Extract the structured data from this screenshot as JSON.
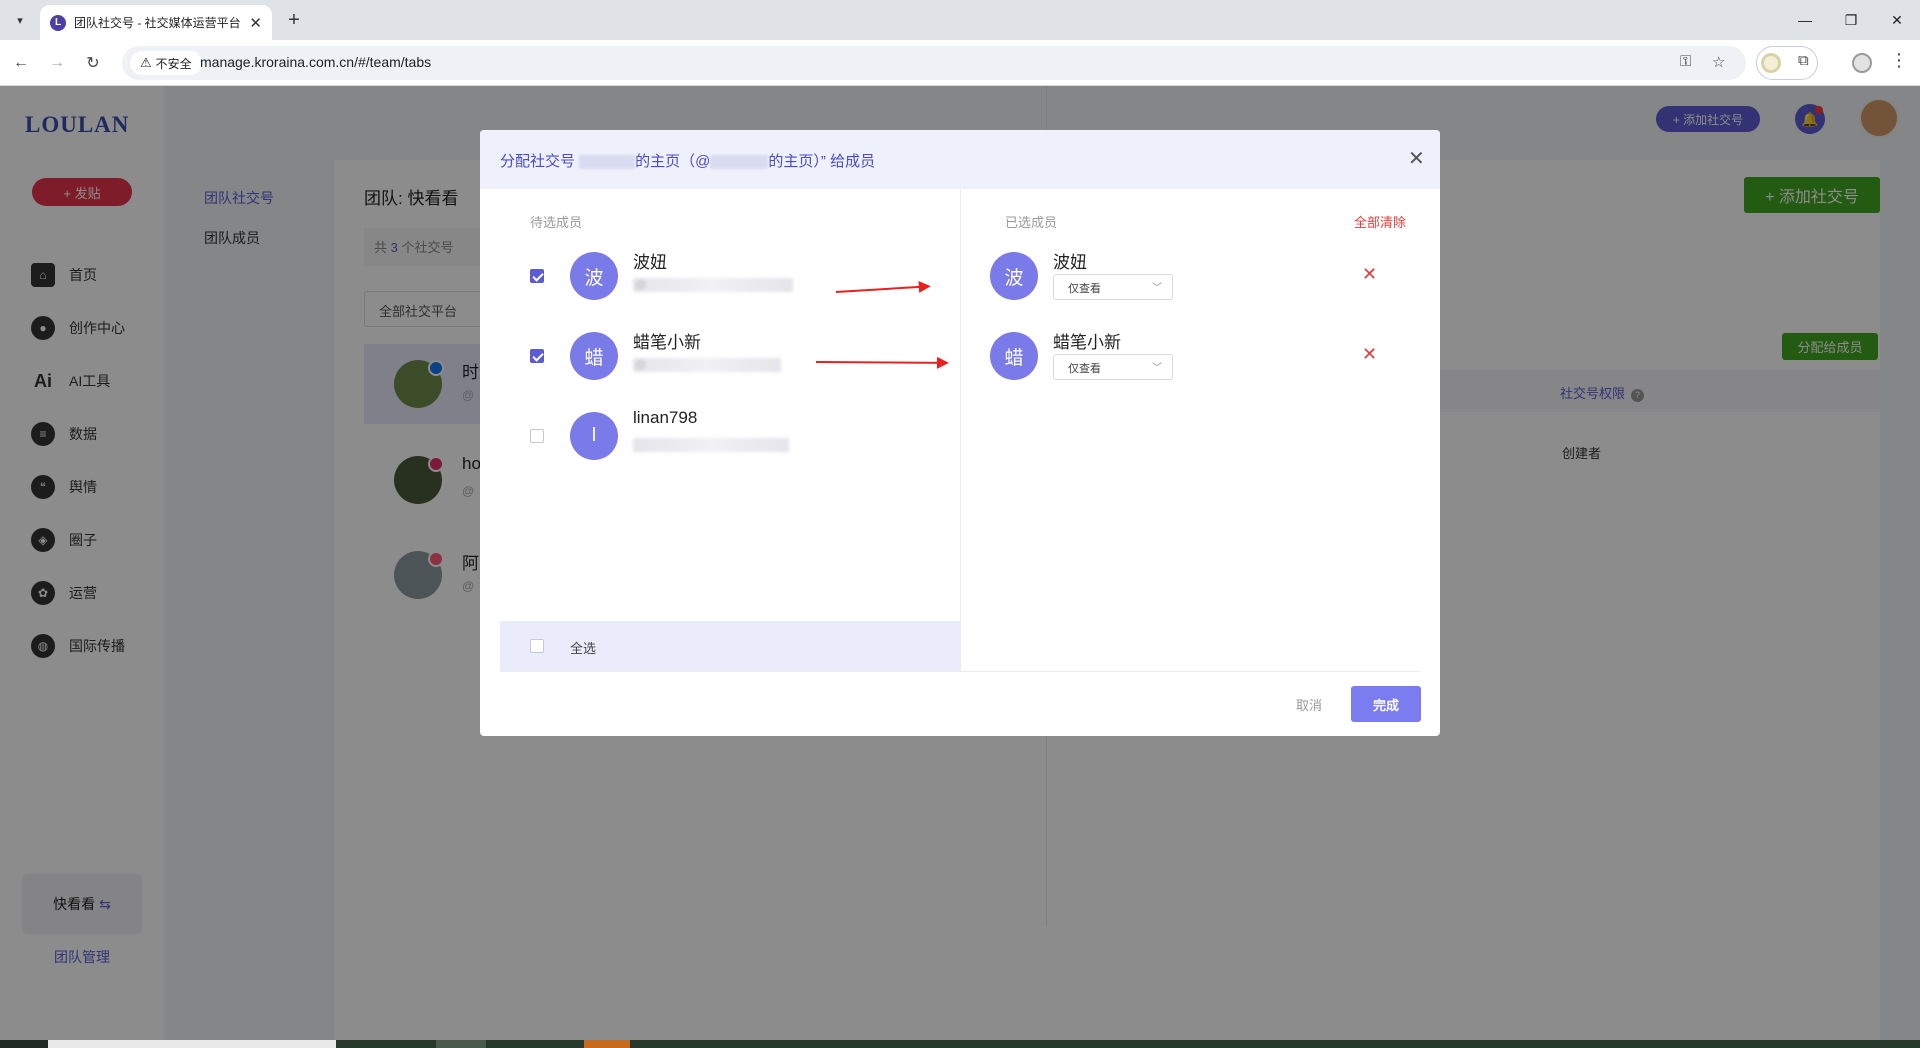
{
  "browser": {
    "tab_title": "团队社交号 - 社交媒体运营平台",
    "security_label": "不安全",
    "url": "manage.kroraina.com.cn/#/team/tabs"
  },
  "app": {
    "logo": "LOULAN",
    "publish_label": "+ 发贴",
    "nav": [
      {
        "label": "首页",
        "icon": "home-icon"
      },
      {
        "label": "创作中心",
        "icon": "palette-icon"
      },
      {
        "label": "AI工具",
        "icon": "ai-icon"
      },
      {
        "label": "数据",
        "icon": "database-icon"
      },
      {
        "label": "舆情",
        "icon": "quote-icon"
      },
      {
        "label": "圈子",
        "icon": "compass-icon"
      },
      {
        "label": "运营",
        "icon": "operation-icon"
      },
      {
        "label": "国际传播",
        "icon": "globe-icon"
      }
    ],
    "team_switch": "快看看",
    "team_manage": "团队管理",
    "subnav": {
      "accounts": "团队社交号",
      "members": "团队成员"
    },
    "team_title": "团队: 快看看",
    "count_prefix": "共",
    "count_value": "3",
    "count_suffix": "个社交号",
    "platform_filter": "全部社交平台",
    "accounts": [
      {
        "name": "时",
        "handle": "@",
        "platform": "facebook"
      },
      {
        "name": "ho",
        "handle": "@",
        "platform": "instagram"
      },
      {
        "name": "阿",
        "handle": "@",
        "platform": "other"
      }
    ],
    "top_add_label": "+ 添加社交号",
    "add_social_label": "+ 添加社交号",
    "assign_label": "分配给成员",
    "perm_header": "社交号权限",
    "creator_label": "创建者"
  },
  "modal": {
    "title_part1": "分配社交号 ",
    "title_part2": "的主页（@",
    "title_part3": "的主页）” 给成员",
    "pending_header": "待选成员",
    "selected_header": "已选成员",
    "clear_all": "全部清除",
    "candidates": [
      {
        "initial": "波",
        "name": "波妞",
        "handle": "@",
        "checked": true
      },
      {
        "initial": "蜡",
        "name": "蜡笔小新",
        "handle": "@",
        "checked": true
      },
      {
        "initial": "l",
        "name": "linan798",
        "handle": "",
        "checked": false
      }
    ],
    "select_all": "全选",
    "selected": [
      {
        "initial": "波",
        "name": "波妞",
        "permission": "仅查看"
      },
      {
        "initial": "蜡",
        "name": "蜡笔小新",
        "permission": "仅查看"
      }
    ],
    "cancel_label": "取消",
    "done_label": "完成"
  },
  "colors": {
    "accent": "#5b5bd6",
    "danger": "#e83a3a",
    "success": "#3fa61f",
    "avatar": "#7a7ae8"
  }
}
